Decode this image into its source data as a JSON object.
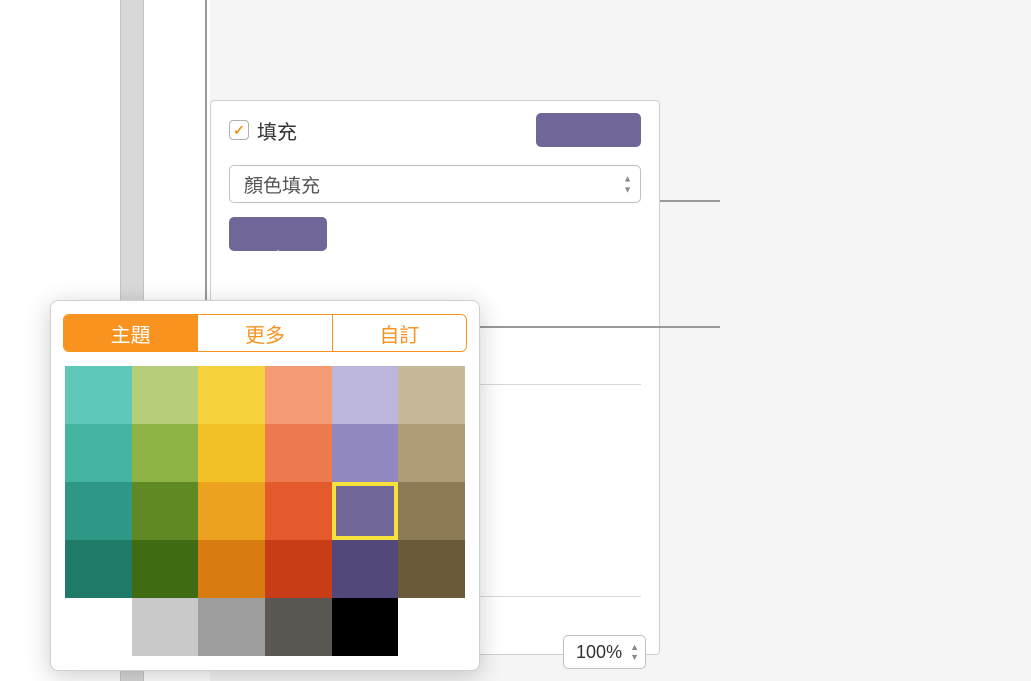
{
  "fill": {
    "label": "填充",
    "checked": true,
    "dropdown_value": "顏色填充",
    "preview_color": "#706698",
    "well_color": "#706698"
  },
  "popover": {
    "tabs": [
      {
        "label": "主題",
        "active": true
      },
      {
        "label": "更多",
        "active": false
      },
      {
        "label": "自訂",
        "active": false
      }
    ],
    "colors": [
      [
        "#5ec8ba",
        "#b6cd79",
        "#f5d23c",
        "#f59b74",
        "#bcb6dc",
        "#c6b99a"
      ],
      [
        "#44b4a0",
        "#8fb244",
        "#f2c126",
        "#ed7a4e",
        "#9188c0",
        "#b09c77"
      ],
      [
        "#2f9786",
        "#5f8a23",
        "#eca21e",
        "#e55a2c",
        "#706698",
        "#8c7b55"
      ],
      [
        "#1f7a67",
        "#3f6b12",
        "#d87c12",
        "#c83c17",
        "#524879",
        "#6a5a3a"
      ],
      [
        "#ffffff",
        "#c9c9c9",
        "#9e9e9e",
        "#5a5651",
        "#000000",
        ""
      ]
    ],
    "selected": {
      "row": 2,
      "col": 4
    }
  },
  "zoom": {
    "value": "100%"
  }
}
